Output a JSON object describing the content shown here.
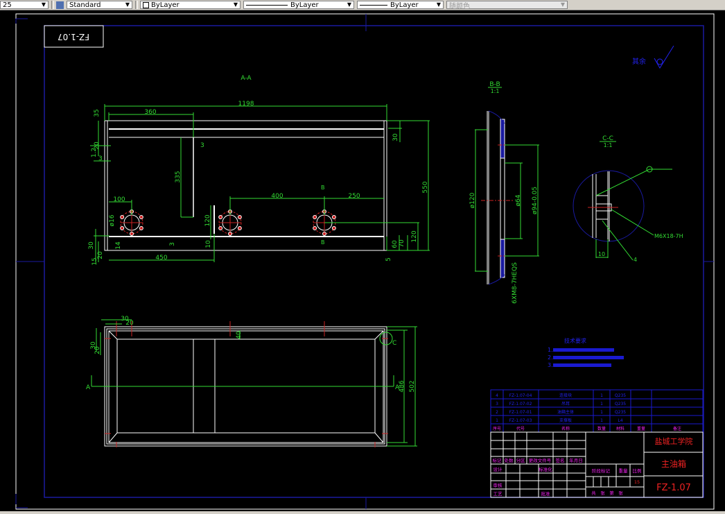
{
  "toolbar": {
    "dimscale": "25",
    "text_style": "Standard",
    "layer_color": "ByLayer",
    "linetype": "ByLayer",
    "lineweight": "ByLayer",
    "plot_style": "随颜色"
  },
  "colors": {
    "background": "#000000",
    "geometry": "#ffffff",
    "dimension": "#33dd33",
    "centerline": "#cc2222",
    "frame": "#1a1aa0",
    "annotation": "#2222ee",
    "title_red": "#ee2222",
    "title_magenta": "#ee22ee"
  },
  "drawing": {
    "mirrored_number": "FZ-1.07",
    "roughness_label": "其余",
    "view_aa": {
      "label": "A-A",
      "dims": [
        "1198",
        "360",
        "550",
        "335",
        "400",
        "250",
        "100",
        "450",
        "120",
        "30",
        "35",
        "20",
        "3",
        "14",
        "10",
        "60",
        "70",
        "120",
        "5",
        "15",
        "20",
        "30",
        "ø16",
        "3",
        "1.2",
        "3"
      ],
      "section_mark": "B"
    },
    "view_bb": {
      "label": "B-B",
      "scale": "1:1",
      "dims": [
        "ø120",
        "ø64",
        "ø94-0.05",
        "6XM8-7HEQS"
      ]
    },
    "view_cc": {
      "label": "C-C",
      "scale": "1:1",
      "dims": [
        "M6X18-7H",
        "10",
        "4"
      ]
    },
    "view_top": {
      "section": "A",
      "detail": "C",
      "dims": [
        "30",
        "20",
        "30",
        "20",
        "40",
        "486",
        "502"
      ]
    }
  },
  "tech_requirements": {
    "title": "技术要求",
    "items": [
      "1.",
      "2.",
      "3."
    ]
  },
  "parts_list": {
    "headers": [
      "序号",
      "代号",
      "名称",
      "数量",
      "材料",
      "重量",
      "备注"
    ],
    "rows": [
      [
        "4",
        "FZ-1.07-04",
        "连接块",
        "1",
        "Q235"
      ],
      [
        "3",
        "FZ-1.07-02",
        "吊耳",
        "1",
        "Q235"
      ],
      [
        "2",
        "FZ-1.07-01",
        "油箱主体",
        "1",
        "Q235"
      ],
      [
        "1",
        "FZ-1.07-03",
        "支撑板",
        "1",
        "L4"
      ]
    ]
  },
  "title_block": {
    "school": "盐城工学院",
    "part_name": "主油箱",
    "drawing_no": "FZ-1.07",
    "labels": [
      "标记",
      "处数",
      "分区",
      "更改文件号",
      "签名",
      "年月日",
      "设计",
      "标准化",
      "审核",
      "工艺",
      "批准",
      "阶段标记",
      "重量",
      "比例",
      "共　张　第　张"
    ],
    "scale": "15"
  }
}
